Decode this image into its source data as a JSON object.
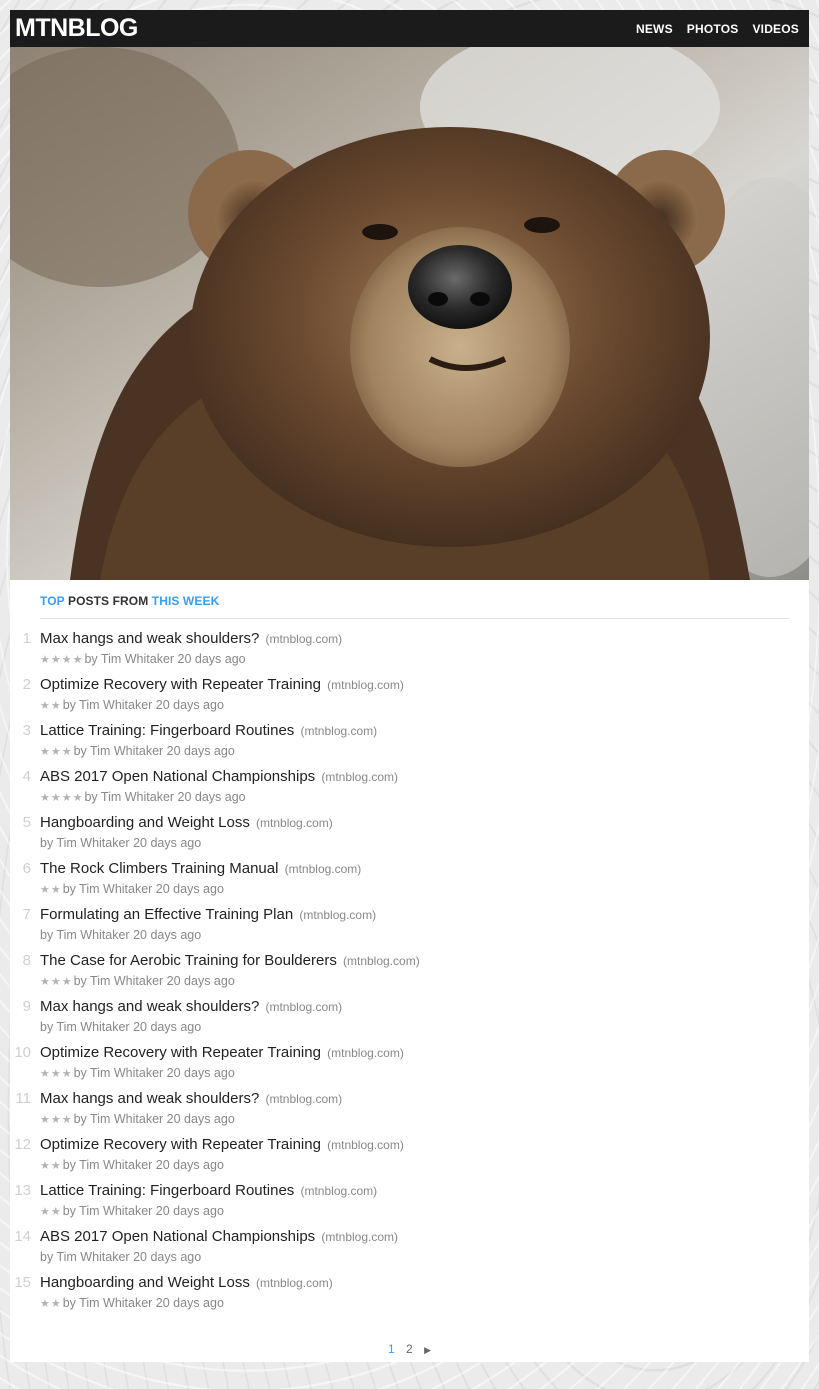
{
  "header": {
    "logo": "MTNBLOG",
    "nav": [
      "NEWS",
      "PHOTOS",
      "VIDEOS"
    ]
  },
  "section": {
    "title_top": "TOP",
    "title_mid": " POSTS FROM ",
    "title_week": "THIS WEEK"
  },
  "posts": [
    {
      "num": "1",
      "title": "Max hangs and weak shoulders?",
      "domain": "(mtnblog.com)",
      "stars": 4,
      "meta": "by Tim Whitaker 20 days ago"
    },
    {
      "num": "2",
      "title": "Optimize Recovery with Repeater Training",
      "domain": "(mtnblog.com)",
      "stars": 2,
      "meta": "by Tim Whitaker 20 days ago"
    },
    {
      "num": "3",
      "title": "Lattice Training: Fingerboard Routines",
      "domain": "(mtnblog.com)",
      "stars": 3,
      "meta": "by Tim Whitaker 20 days ago"
    },
    {
      "num": "4",
      "title": "ABS 2017 Open National Championships",
      "domain": "(mtnblog.com)",
      "stars": 4,
      "meta": "by Tim Whitaker 20 days ago"
    },
    {
      "num": "5",
      "title": "Hangboarding and Weight Loss",
      "domain": "(mtnblog.com)",
      "stars": 0,
      "meta": "by Tim Whitaker 20 days ago"
    },
    {
      "num": "6",
      "title": "The Rock Climbers Training Manual",
      "domain": "(mtnblog.com)",
      "stars": 2,
      "meta": "by Tim Whitaker 20 days ago"
    },
    {
      "num": "7",
      "title": "Formulating an Effective Training Plan",
      "domain": "(mtnblog.com)",
      "stars": 0,
      "meta": "by Tim Whitaker 20 days ago"
    },
    {
      "num": "8",
      "title": "The Case for Aerobic Training for Boulderers",
      "domain": "(mtnblog.com)",
      "stars": 3,
      "meta": "by Tim Whitaker 20 days ago"
    },
    {
      "num": "9",
      "title": "Max hangs and weak shoulders?",
      "domain": "(mtnblog.com)",
      "stars": 0,
      "meta": "by Tim Whitaker 20 days ago"
    },
    {
      "num": "10",
      "title": "Optimize Recovery with Repeater Training",
      "domain": "(mtnblog.com)",
      "stars": 3,
      "meta": "by Tim Whitaker 20 days ago"
    },
    {
      "num": "11",
      "title": "Max hangs and weak shoulders?",
      "domain": "(mtnblog.com)",
      "stars": 3,
      "meta": "by Tim Whitaker 20 days ago"
    },
    {
      "num": "12",
      "title": "Optimize Recovery with Repeater Training",
      "domain": "(mtnblog.com)",
      "stars": 2,
      "meta": "by Tim Whitaker 20 days ago"
    },
    {
      "num": "13",
      "title": "Lattice Training: Fingerboard Routines",
      "domain": "(mtnblog.com)",
      "stars": 2,
      "meta": "by Tim Whitaker 20 days ago"
    },
    {
      "num": "14",
      "title": "ABS 2017 Open National Championships",
      "domain": "(mtnblog.com)",
      "stars": 0,
      "meta": "by Tim Whitaker 20 days ago"
    },
    {
      "num": "15",
      "title": "Hangboarding and Weight Loss",
      "domain": "(mtnblog.com)",
      "stars": 2,
      "meta": "by Tim Whitaker 20 days ago"
    }
  ],
  "pagination": {
    "current": "1",
    "pages": [
      "2"
    ],
    "next_icon": "chevron-right-icon"
  },
  "colors": {
    "accent": "#3a9ef0",
    "header_bg": "#1b1b1b",
    "star": "#b3b3b3"
  }
}
